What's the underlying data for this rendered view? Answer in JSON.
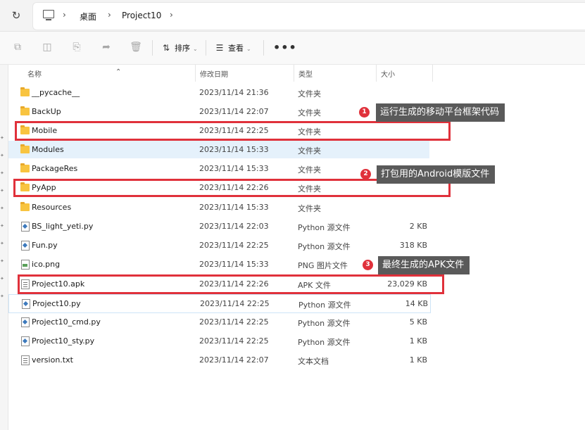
{
  "address_bar": {
    "refresh_icon": "refresh-icon",
    "computer_icon": "computer-icon",
    "breadcrumb": [
      "桌面",
      "Project10"
    ]
  },
  "toolbar": {
    "sort_label": "排序",
    "view_label": "查看",
    "more_label": "•••"
  },
  "columns": {
    "name": "名称",
    "date": "修改日期",
    "type": "类型",
    "size": "大小"
  },
  "files": [
    {
      "name": "__pycache__",
      "date": "2023/11/14 21:36",
      "type": "文件夹",
      "size": "",
      "icon": "folder-icon"
    },
    {
      "name": "BackUp",
      "date": "2023/11/14 22:07",
      "type": "文件夹",
      "size": "",
      "icon": "folder-icon"
    },
    {
      "name": "Mobile",
      "date": "2023/11/14 22:25",
      "type": "文件夹",
      "size": "",
      "icon": "folder-icon"
    },
    {
      "name": "Modules",
      "date": "2023/11/14 15:33",
      "type": "文件夹",
      "size": "",
      "icon": "folder-icon"
    },
    {
      "name": "PackageRes",
      "date": "2023/11/14 15:33",
      "type": "文件夹",
      "size": "",
      "icon": "folder-icon"
    },
    {
      "name": "PyApp",
      "date": "2023/11/14 22:26",
      "type": "文件夹",
      "size": "",
      "icon": "folder-icon"
    },
    {
      "name": "Resources",
      "date": "2023/11/14 15:33",
      "type": "文件夹",
      "size": "",
      "icon": "folder-icon"
    },
    {
      "name": "BS_light_yeti.py",
      "date": "2023/11/14 22:03",
      "type": "Python 源文件",
      "size": "2 KB",
      "icon": "python-file-icon"
    },
    {
      "name": "Fun.py",
      "date": "2023/11/14 22:25",
      "type": "Python 源文件",
      "size": "318 KB",
      "icon": "python-file-icon"
    },
    {
      "name": "ico.png",
      "date": "2023/11/14 15:33",
      "type": "PNG 图片文件",
      "size": "",
      "icon": "image-file-icon"
    },
    {
      "name": "Project10.apk",
      "date": "2023/11/14 22:26",
      "type": "APK 文件",
      "size": "23,029 KB",
      "icon": "document-icon"
    },
    {
      "name": "Project10.py",
      "date": "2023/11/14 22:25",
      "type": "Python 源文件",
      "size": "14 KB",
      "icon": "python-file-icon"
    },
    {
      "name": "Project10_cmd.py",
      "date": "2023/11/14 22:25",
      "type": "Python 源文件",
      "size": "5 KB",
      "icon": "python-file-icon"
    },
    {
      "name": "Project10_sty.py",
      "date": "2023/11/14 22:25",
      "type": "Python 源文件",
      "size": "1 KB",
      "icon": "python-file-icon"
    },
    {
      "name": "version.txt",
      "date": "2023/11/14 22:07",
      "type": "文本文档",
      "size": "1 KB",
      "icon": "text-file-icon"
    }
  ],
  "annotations": [
    {
      "number": "1",
      "text": "运行生成的移动平台框架代码"
    },
    {
      "number": "2",
      "text": "打包用的Android模版文件"
    },
    {
      "number": "3",
      "text": "最终生成的APK文件"
    }
  ],
  "colors": {
    "highlight_red": "#e0313b",
    "callout_bg": "#5a5a5a",
    "selection": "#e5f1fb",
    "folder": "#f8c440"
  }
}
